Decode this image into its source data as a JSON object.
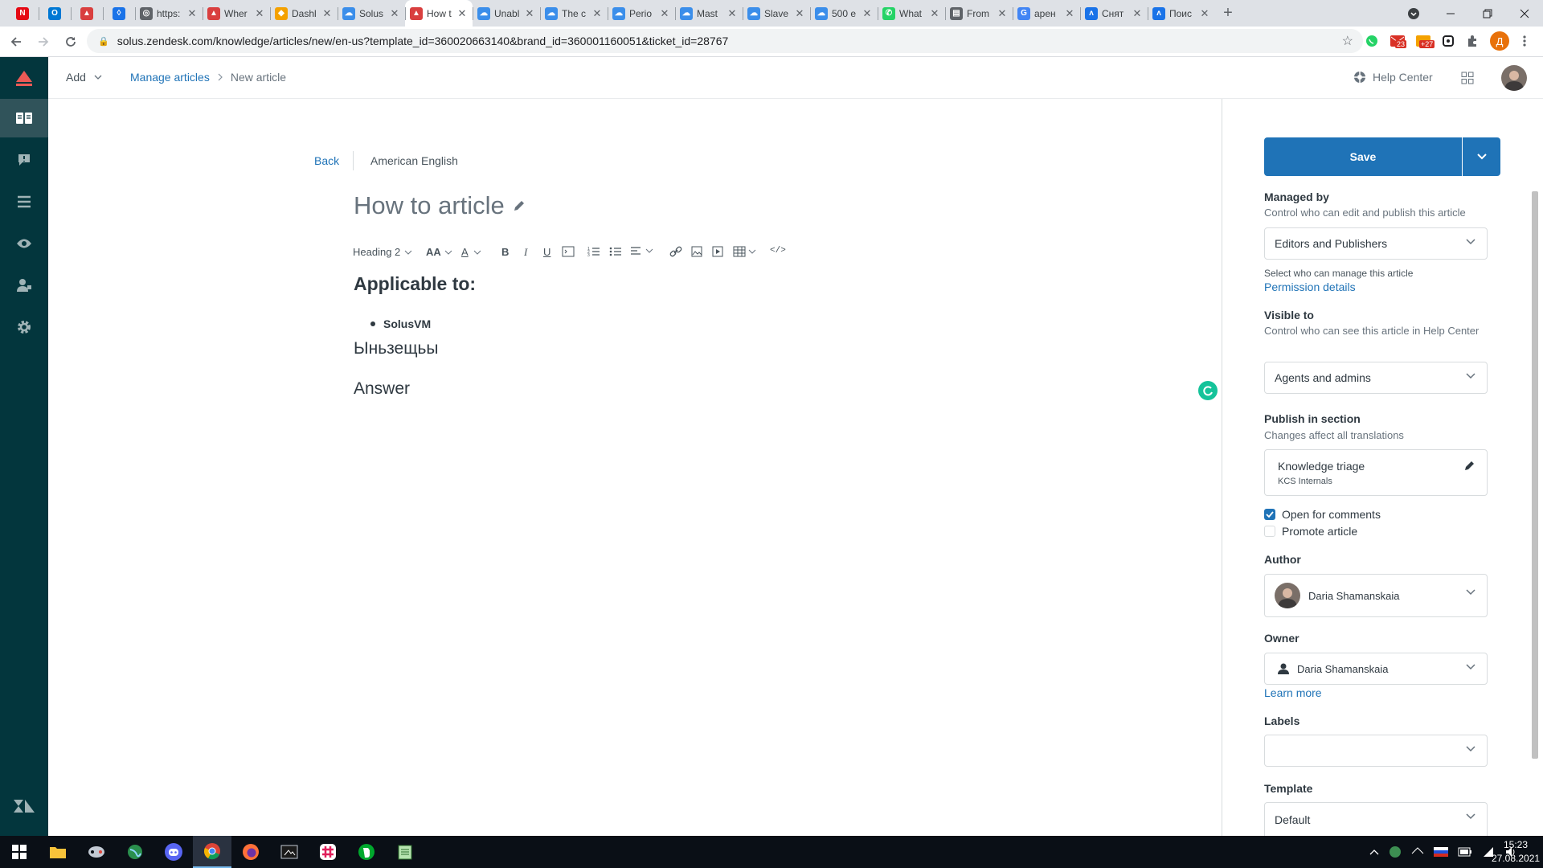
{
  "browser": {
    "tabs": [
      {
        "label": "",
        "color": "#e50914",
        "icon": "netflix-icon",
        "glyph": "N",
        "pinned": true
      },
      {
        "label": "",
        "color": "#0078d4",
        "icon": "outlook-icon",
        "glyph": "O",
        "pinned": true
      },
      {
        "label": "",
        "color": "#d93f3f",
        "icon": "zendesk-icon",
        "glyph": "▲",
        "pinned": true
      },
      {
        "label": "",
        "color": "#1a73e8",
        "icon": "drop-icon",
        "glyph": "◊",
        "pinned": true
      },
      {
        "label": "https:",
        "color": "#5f6368",
        "icon": "globe-icon",
        "glyph": "◎"
      },
      {
        "label": "Wher",
        "color": "#d93f3f",
        "icon": "zendesk-icon",
        "glyph": "▲"
      },
      {
        "label": "Dashl",
        "color": "#f4a100",
        "icon": "dashboard-icon",
        "glyph": "◆"
      },
      {
        "label": "Solus",
        "color": "#3b8eea",
        "icon": "cloud-icon",
        "glyph": "☁"
      },
      {
        "label": "How t",
        "color": "#d93f3f",
        "icon": "zendesk-icon",
        "glyph": "▲",
        "active": true
      },
      {
        "label": "Unabl",
        "color": "#3b8eea",
        "icon": "cloud-icon",
        "glyph": "☁"
      },
      {
        "label": "The c",
        "color": "#3b8eea",
        "icon": "cloud-icon",
        "glyph": "☁"
      },
      {
        "label": "Perio",
        "color": "#3b8eea",
        "icon": "cloud-icon",
        "glyph": "☁"
      },
      {
        "label": "Mast",
        "color": "#3b8eea",
        "icon": "cloud-icon",
        "glyph": "☁"
      },
      {
        "label": "Slave",
        "color": "#3b8eea",
        "icon": "cloud-icon",
        "glyph": "☁"
      },
      {
        "label": "500 e",
        "color": "#3b8eea",
        "icon": "cloud-icon",
        "glyph": "☁"
      },
      {
        "label": "What",
        "color": "#25d366",
        "icon": "whatsapp-icon",
        "glyph": "✆"
      },
      {
        "label": "From",
        "color": "#5f6368",
        "icon": "doc-icon",
        "glyph": "▤"
      },
      {
        "label": "арен",
        "color": "#4285f4",
        "icon": "google-icon",
        "glyph": "G"
      },
      {
        "label": "Снят",
        "color": "#1a73e8",
        "icon": "jira-icon",
        "glyph": "ʌ"
      },
      {
        "label": "Поис",
        "color": "#1a73e8",
        "icon": "jira-icon",
        "glyph": "ʌ"
      }
    ],
    "url": "solus.zendesk.com/knowledge/articles/new/en-us?template_id=360020663140&brand_id=360001160051&ticket_id=28767",
    "badge_mail": "23",
    "badge_ext": "+27",
    "profile_letter": "Д"
  },
  "header": {
    "add_label": "Add",
    "breadcrumb_manage": "Manage articles",
    "breadcrumb_current": "New article",
    "help_center": "Help Center"
  },
  "editor": {
    "back_label": "Back",
    "language": "American English",
    "title": "How to article",
    "format_select": "Heading 2",
    "font_size_glyph": "AA",
    "text_color_glyph": "A",
    "bold_glyph": "B",
    "italic_glyph": "I",
    "underline_glyph": "U",
    "code_glyph": "</>",
    "content": {
      "heading": "Applicable to:",
      "bullet": "SolusVM",
      "line1": "Ыньзещьы",
      "line2": "Answer"
    }
  },
  "sidebar": {
    "save_label": "Save",
    "managed_by": {
      "label": "Managed by",
      "hint": "Control who can edit and publish this article",
      "value": "Editors and Publishers",
      "note": "Select who can manage this article",
      "link": "Permission details"
    },
    "visible_to": {
      "label": "Visible to",
      "hint": "Control who can see this article in Help Center",
      "value": "Agents and admins"
    },
    "section": {
      "label": "Publish in section",
      "hint": "Changes affect all translations",
      "name": "Knowledge triage",
      "category": "KCS Internals"
    },
    "open_comments": {
      "label": "Open for comments",
      "checked": true
    },
    "promote": {
      "label": "Promote article",
      "checked": false
    },
    "author": {
      "label": "Author",
      "value": "Daria Shamanskaia"
    },
    "owner": {
      "label": "Owner",
      "value": "Daria Shamanskaia",
      "link": "Learn more"
    },
    "labels": {
      "label": "Labels",
      "value": ""
    },
    "template": {
      "label": "Template",
      "value": "Default"
    }
  },
  "taskbar": {
    "time": "15:23",
    "date": "27.08.2021"
  },
  "colors": {
    "accent": "#1f73b7",
    "nav_bg": "#03363d",
    "grammarly": "#15c39a"
  }
}
